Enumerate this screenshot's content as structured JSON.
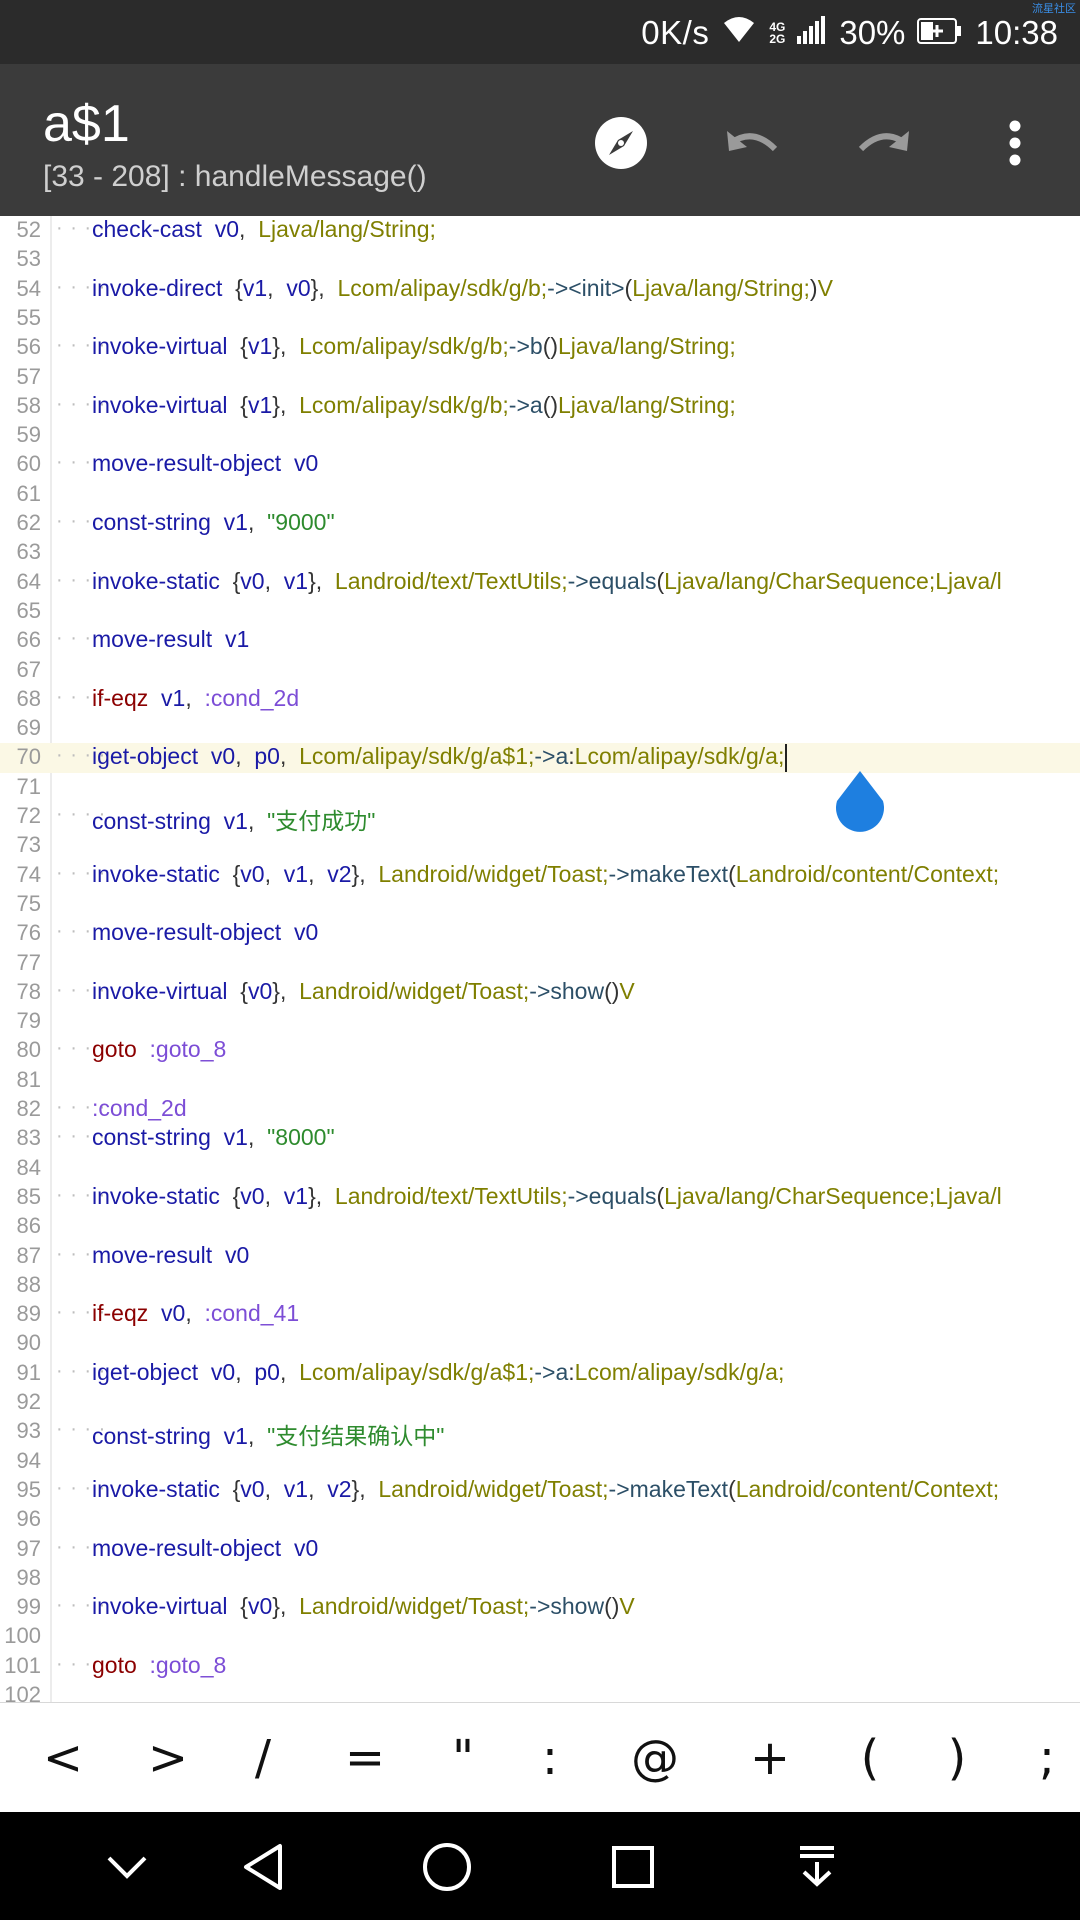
{
  "status_bar": {
    "watermark": "流星社区",
    "net_speed": "0K/s",
    "net_type_top": "4G",
    "net_type_bottom": "2G",
    "battery": "30%",
    "time": "10:38"
  },
  "app_bar": {
    "title": "a$1",
    "subtitle": "[33 - 208] : handleMessage()",
    "icons": [
      "compass-icon",
      "undo-icon",
      "redo-icon",
      "more-vert-icon"
    ]
  },
  "editor": {
    "cursor_line": 70,
    "lines": [
      {
        "n": "52",
        "t": [
          [
            "check-cast",
            "kw"
          ],
          [
            "  ",
            "p"
          ],
          [
            "v0",
            "reg"
          ],
          [
            ",  ",
            "p"
          ],
          [
            "Ljava/lang/String;",
            "type"
          ]
        ]
      },
      {
        "n": "53",
        "t": []
      },
      {
        "n": "54",
        "t": [
          [
            "invoke-direct",
            "kw"
          ],
          [
            "  {",
            "p"
          ],
          [
            "v1",
            "reg"
          ],
          [
            ",  ",
            "p"
          ],
          [
            "v0",
            "reg"
          ],
          [
            "},  ",
            "p"
          ],
          [
            "Lcom/alipay/sdk/g/b;",
            "type"
          ],
          [
            "-><init>",
            "mth"
          ],
          [
            "(",
            "p"
          ],
          [
            "Ljava/lang/String;",
            "type"
          ],
          [
            ")",
            "p"
          ],
          [
            "V",
            "type"
          ]
        ]
      },
      {
        "n": "55",
        "t": []
      },
      {
        "n": "56",
        "t": [
          [
            "invoke-virtual",
            "kw"
          ],
          [
            "  {",
            "p"
          ],
          [
            "v1",
            "reg"
          ],
          [
            "},  ",
            "p"
          ],
          [
            "Lcom/alipay/sdk/g/b;",
            "type"
          ],
          [
            "->b",
            "mth"
          ],
          [
            "()",
            "p"
          ],
          [
            "Ljava/lang/String;",
            "type"
          ]
        ]
      },
      {
        "n": "57",
        "t": []
      },
      {
        "n": "58",
        "t": [
          [
            "invoke-virtual",
            "kw"
          ],
          [
            "  {",
            "p"
          ],
          [
            "v1",
            "reg"
          ],
          [
            "},  ",
            "p"
          ],
          [
            "Lcom/alipay/sdk/g/b;",
            "type"
          ],
          [
            "->a",
            "mth"
          ],
          [
            "()",
            "p"
          ],
          [
            "Ljava/lang/String;",
            "type"
          ]
        ]
      },
      {
        "n": "59",
        "t": []
      },
      {
        "n": "60",
        "t": [
          [
            "move-result-object",
            "kw"
          ],
          [
            "  ",
            "p"
          ],
          [
            "v0",
            "reg"
          ]
        ]
      },
      {
        "n": "61",
        "t": []
      },
      {
        "n": "62",
        "t": [
          [
            "const-string",
            "kw"
          ],
          [
            "  ",
            "p"
          ],
          [
            "v1",
            "reg"
          ],
          [
            ",  ",
            "p"
          ],
          [
            "\"9000\"",
            "str"
          ]
        ]
      },
      {
        "n": "63",
        "t": []
      },
      {
        "n": "64",
        "t": [
          [
            "invoke-static",
            "kw"
          ],
          [
            "  {",
            "p"
          ],
          [
            "v0",
            "reg"
          ],
          [
            ",  ",
            "p"
          ],
          [
            "v1",
            "reg"
          ],
          [
            "},  ",
            "p"
          ],
          [
            "Landroid/text/TextUtils;",
            "type"
          ],
          [
            "->equals",
            "mth"
          ],
          [
            "(",
            "p"
          ],
          [
            "Ljava/lang/CharSequence;Ljava/l",
            "type"
          ]
        ]
      },
      {
        "n": "65",
        "t": []
      },
      {
        "n": "66",
        "t": [
          [
            "move-result",
            "kw"
          ],
          [
            "  ",
            "p"
          ],
          [
            "v1",
            "reg"
          ]
        ]
      },
      {
        "n": "67",
        "t": []
      },
      {
        "n": "68",
        "t": [
          [
            "if-eqz",
            "ctl"
          ],
          [
            "  ",
            "p"
          ],
          [
            "v1",
            "reg"
          ],
          [
            ",  ",
            "p"
          ],
          [
            ":cond_2d",
            "lbl"
          ]
        ]
      },
      {
        "n": "69",
        "t": []
      },
      {
        "n": "70",
        "t": [
          [
            "iget-object",
            "kw"
          ],
          [
            "  ",
            "p"
          ],
          [
            "v0",
            "reg"
          ],
          [
            ",  ",
            "p"
          ],
          [
            "p0",
            "reg"
          ],
          [
            ",  ",
            "p"
          ],
          [
            "Lcom/alipay/sdk/g/a$1;",
            "type"
          ],
          [
            "->a",
            "mth"
          ],
          [
            ":",
            "p"
          ],
          [
            "Lcom/alipay/sdk/g/a;",
            "type"
          ]
        ]
      },
      {
        "n": "71",
        "t": []
      },
      {
        "n": "72",
        "t": [
          [
            "const-string",
            "kw"
          ],
          [
            "  ",
            "p"
          ],
          [
            "v1",
            "reg"
          ],
          [
            ",  ",
            "p"
          ],
          [
            "\"支付成功\"",
            "str"
          ]
        ]
      },
      {
        "n": "73",
        "t": []
      },
      {
        "n": "74",
        "t": [
          [
            "invoke-static",
            "kw"
          ],
          [
            "  {",
            "p"
          ],
          [
            "v0",
            "reg"
          ],
          [
            ",  ",
            "p"
          ],
          [
            "v1",
            "reg"
          ],
          [
            ",  ",
            "p"
          ],
          [
            "v2",
            "reg"
          ],
          [
            "},  ",
            "p"
          ],
          [
            "Landroid/widget/Toast;",
            "type"
          ],
          [
            "->makeText",
            "mth"
          ],
          [
            "(",
            "p"
          ],
          [
            "Landroid/content/Context;",
            "type"
          ]
        ]
      },
      {
        "n": "75",
        "t": []
      },
      {
        "n": "76",
        "t": [
          [
            "move-result-object",
            "kw"
          ],
          [
            "  ",
            "p"
          ],
          [
            "v0",
            "reg"
          ]
        ]
      },
      {
        "n": "77",
        "t": []
      },
      {
        "n": "78",
        "t": [
          [
            "invoke-virtual",
            "kw"
          ],
          [
            "  {",
            "p"
          ],
          [
            "v0",
            "reg"
          ],
          [
            "},  ",
            "p"
          ],
          [
            "Landroid/widget/Toast;",
            "type"
          ],
          [
            "->show",
            "mth"
          ],
          [
            "()",
            "p"
          ],
          [
            "V",
            "type"
          ]
        ]
      },
      {
        "n": "79",
        "t": []
      },
      {
        "n": "80",
        "t": [
          [
            "goto",
            "ctl"
          ],
          [
            "  ",
            "p"
          ],
          [
            ":goto_8",
            "lbl"
          ]
        ]
      },
      {
        "n": "81",
        "t": []
      },
      {
        "n": "82",
        "t": [
          [
            ":cond_2d",
            "lbl"
          ]
        ]
      },
      {
        "n": "83",
        "t": [
          [
            "const-string",
            "kw"
          ],
          [
            "  ",
            "p"
          ],
          [
            "v1",
            "reg"
          ],
          [
            ",  ",
            "p"
          ],
          [
            "\"8000\"",
            "str"
          ]
        ]
      },
      {
        "n": "84",
        "t": []
      },
      {
        "n": "85",
        "t": [
          [
            "invoke-static",
            "kw"
          ],
          [
            "  {",
            "p"
          ],
          [
            "v0",
            "reg"
          ],
          [
            ",  ",
            "p"
          ],
          [
            "v1",
            "reg"
          ],
          [
            "},  ",
            "p"
          ],
          [
            "Landroid/text/TextUtils;",
            "type"
          ],
          [
            "->equals",
            "mth"
          ],
          [
            "(",
            "p"
          ],
          [
            "Ljava/lang/CharSequence;Ljava/l",
            "type"
          ]
        ]
      },
      {
        "n": "86",
        "t": []
      },
      {
        "n": "87",
        "t": [
          [
            "move-result",
            "kw"
          ],
          [
            "  ",
            "p"
          ],
          [
            "v0",
            "reg"
          ]
        ]
      },
      {
        "n": "88",
        "t": []
      },
      {
        "n": "89",
        "t": [
          [
            "if-eqz",
            "ctl"
          ],
          [
            "  ",
            "p"
          ],
          [
            "v0",
            "reg"
          ],
          [
            ",  ",
            "p"
          ],
          [
            ":cond_41",
            "lbl"
          ]
        ]
      },
      {
        "n": "90",
        "t": []
      },
      {
        "n": "91",
        "t": [
          [
            "iget-object",
            "kw"
          ],
          [
            "  ",
            "p"
          ],
          [
            "v0",
            "reg"
          ],
          [
            ",  ",
            "p"
          ],
          [
            "p0",
            "reg"
          ],
          [
            ",  ",
            "p"
          ],
          [
            "Lcom/alipay/sdk/g/a$1;",
            "type"
          ],
          [
            "->a",
            "mth"
          ],
          [
            ":",
            "p"
          ],
          [
            "Lcom/alipay/sdk/g/a;",
            "type"
          ]
        ]
      },
      {
        "n": "92",
        "t": []
      },
      {
        "n": "93",
        "t": [
          [
            "const-string",
            "kw"
          ],
          [
            "  ",
            "p"
          ],
          [
            "v1",
            "reg"
          ],
          [
            ",  ",
            "p"
          ],
          [
            "\"支付结果确认中\"",
            "str"
          ]
        ]
      },
      {
        "n": "94",
        "t": []
      },
      {
        "n": "95",
        "t": [
          [
            "invoke-static",
            "kw"
          ],
          [
            "  {",
            "p"
          ],
          [
            "v0",
            "reg"
          ],
          [
            ",  ",
            "p"
          ],
          [
            "v1",
            "reg"
          ],
          [
            ",  ",
            "p"
          ],
          [
            "v2",
            "reg"
          ],
          [
            "},  ",
            "p"
          ],
          [
            "Landroid/widget/Toast;",
            "type"
          ],
          [
            "->makeText",
            "mth"
          ],
          [
            "(",
            "p"
          ],
          [
            "Landroid/content/Context;",
            "type"
          ]
        ]
      },
      {
        "n": "96",
        "t": []
      },
      {
        "n": "97",
        "t": [
          [
            "move-result-object",
            "kw"
          ],
          [
            "  ",
            "p"
          ],
          [
            "v0",
            "reg"
          ]
        ]
      },
      {
        "n": "98",
        "t": []
      },
      {
        "n": "99",
        "t": [
          [
            "invoke-virtual",
            "kw"
          ],
          [
            "  {",
            "p"
          ],
          [
            "v0",
            "reg"
          ],
          [
            "},  ",
            "p"
          ],
          [
            "Landroid/widget/Toast;",
            "type"
          ],
          [
            "->show",
            "mth"
          ],
          [
            "()",
            "p"
          ],
          [
            "V",
            "type"
          ]
        ]
      },
      {
        "n": "100",
        "t": []
      },
      {
        "n": "101",
        "t": [
          [
            "goto",
            "ctl"
          ],
          [
            "  ",
            "p"
          ],
          [
            ":goto_8",
            "lbl"
          ]
        ]
      },
      {
        "n": "102",
        "t": []
      }
    ]
  },
  "symbol_keys": [
    "<",
    ">",
    "/",
    "=",
    "\"",
    ":",
    "@",
    "+",
    "(",
    ")",
    ";"
  ],
  "nav_bar": {
    "icons": [
      "collapse-down-icon",
      "back-icon",
      "home-icon",
      "recents-icon",
      "notification-pull-icon"
    ]
  },
  "colors": {
    "keyword": "#1a1aa6",
    "control": "#8b0000",
    "type": "#7f7f00",
    "string": "#2e8b2e",
    "label": "#7c4dd6",
    "method": "#2c4f67",
    "current_line": "#fbf8e5",
    "app_bar": "#3b3b3b"
  }
}
